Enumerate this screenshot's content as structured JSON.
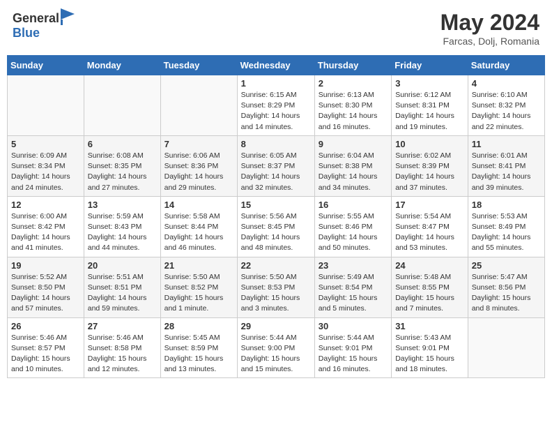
{
  "logo": {
    "general": "General",
    "blue": "Blue"
  },
  "title": {
    "month_year": "May 2024",
    "location": "Farcas, Dolj, Romania"
  },
  "days_of_week": [
    "Sunday",
    "Monday",
    "Tuesday",
    "Wednesday",
    "Thursday",
    "Friday",
    "Saturday"
  ],
  "weeks": [
    [
      {
        "day": "",
        "info": ""
      },
      {
        "day": "",
        "info": ""
      },
      {
        "day": "",
        "info": ""
      },
      {
        "day": "1",
        "info": "Sunrise: 6:15 AM\nSunset: 8:29 PM\nDaylight: 14 hours and 14 minutes."
      },
      {
        "day": "2",
        "info": "Sunrise: 6:13 AM\nSunset: 8:30 PM\nDaylight: 14 hours and 16 minutes."
      },
      {
        "day": "3",
        "info": "Sunrise: 6:12 AM\nSunset: 8:31 PM\nDaylight: 14 hours and 19 minutes."
      },
      {
        "day": "4",
        "info": "Sunrise: 6:10 AM\nSunset: 8:32 PM\nDaylight: 14 hours and 22 minutes."
      }
    ],
    [
      {
        "day": "5",
        "info": "Sunrise: 6:09 AM\nSunset: 8:34 PM\nDaylight: 14 hours and 24 minutes."
      },
      {
        "day": "6",
        "info": "Sunrise: 6:08 AM\nSunset: 8:35 PM\nDaylight: 14 hours and 27 minutes."
      },
      {
        "day": "7",
        "info": "Sunrise: 6:06 AM\nSunset: 8:36 PM\nDaylight: 14 hours and 29 minutes."
      },
      {
        "day": "8",
        "info": "Sunrise: 6:05 AM\nSunset: 8:37 PM\nDaylight: 14 hours and 32 minutes."
      },
      {
        "day": "9",
        "info": "Sunrise: 6:04 AM\nSunset: 8:38 PM\nDaylight: 14 hours and 34 minutes."
      },
      {
        "day": "10",
        "info": "Sunrise: 6:02 AM\nSunset: 8:39 PM\nDaylight: 14 hours and 37 minutes."
      },
      {
        "day": "11",
        "info": "Sunrise: 6:01 AM\nSunset: 8:41 PM\nDaylight: 14 hours and 39 minutes."
      }
    ],
    [
      {
        "day": "12",
        "info": "Sunrise: 6:00 AM\nSunset: 8:42 PM\nDaylight: 14 hours and 41 minutes."
      },
      {
        "day": "13",
        "info": "Sunrise: 5:59 AM\nSunset: 8:43 PM\nDaylight: 14 hours and 44 minutes."
      },
      {
        "day": "14",
        "info": "Sunrise: 5:58 AM\nSunset: 8:44 PM\nDaylight: 14 hours and 46 minutes."
      },
      {
        "day": "15",
        "info": "Sunrise: 5:56 AM\nSunset: 8:45 PM\nDaylight: 14 hours and 48 minutes."
      },
      {
        "day": "16",
        "info": "Sunrise: 5:55 AM\nSunset: 8:46 PM\nDaylight: 14 hours and 50 minutes."
      },
      {
        "day": "17",
        "info": "Sunrise: 5:54 AM\nSunset: 8:47 PM\nDaylight: 14 hours and 53 minutes."
      },
      {
        "day": "18",
        "info": "Sunrise: 5:53 AM\nSunset: 8:49 PM\nDaylight: 14 hours and 55 minutes."
      }
    ],
    [
      {
        "day": "19",
        "info": "Sunrise: 5:52 AM\nSunset: 8:50 PM\nDaylight: 14 hours and 57 minutes."
      },
      {
        "day": "20",
        "info": "Sunrise: 5:51 AM\nSunset: 8:51 PM\nDaylight: 14 hours and 59 minutes."
      },
      {
        "day": "21",
        "info": "Sunrise: 5:50 AM\nSunset: 8:52 PM\nDaylight: 15 hours and 1 minute."
      },
      {
        "day": "22",
        "info": "Sunrise: 5:50 AM\nSunset: 8:53 PM\nDaylight: 15 hours and 3 minutes."
      },
      {
        "day": "23",
        "info": "Sunrise: 5:49 AM\nSunset: 8:54 PM\nDaylight: 15 hours and 5 minutes."
      },
      {
        "day": "24",
        "info": "Sunrise: 5:48 AM\nSunset: 8:55 PM\nDaylight: 15 hours and 7 minutes."
      },
      {
        "day": "25",
        "info": "Sunrise: 5:47 AM\nSunset: 8:56 PM\nDaylight: 15 hours and 8 minutes."
      }
    ],
    [
      {
        "day": "26",
        "info": "Sunrise: 5:46 AM\nSunset: 8:57 PM\nDaylight: 15 hours and 10 minutes."
      },
      {
        "day": "27",
        "info": "Sunrise: 5:46 AM\nSunset: 8:58 PM\nDaylight: 15 hours and 12 minutes."
      },
      {
        "day": "28",
        "info": "Sunrise: 5:45 AM\nSunset: 8:59 PM\nDaylight: 15 hours and 13 minutes."
      },
      {
        "day": "29",
        "info": "Sunrise: 5:44 AM\nSunset: 9:00 PM\nDaylight: 15 hours and 15 minutes."
      },
      {
        "day": "30",
        "info": "Sunrise: 5:44 AM\nSunset: 9:01 PM\nDaylight: 15 hours and 16 minutes."
      },
      {
        "day": "31",
        "info": "Sunrise: 5:43 AM\nSunset: 9:01 PM\nDaylight: 15 hours and 18 minutes."
      },
      {
        "day": "",
        "info": ""
      }
    ]
  ]
}
